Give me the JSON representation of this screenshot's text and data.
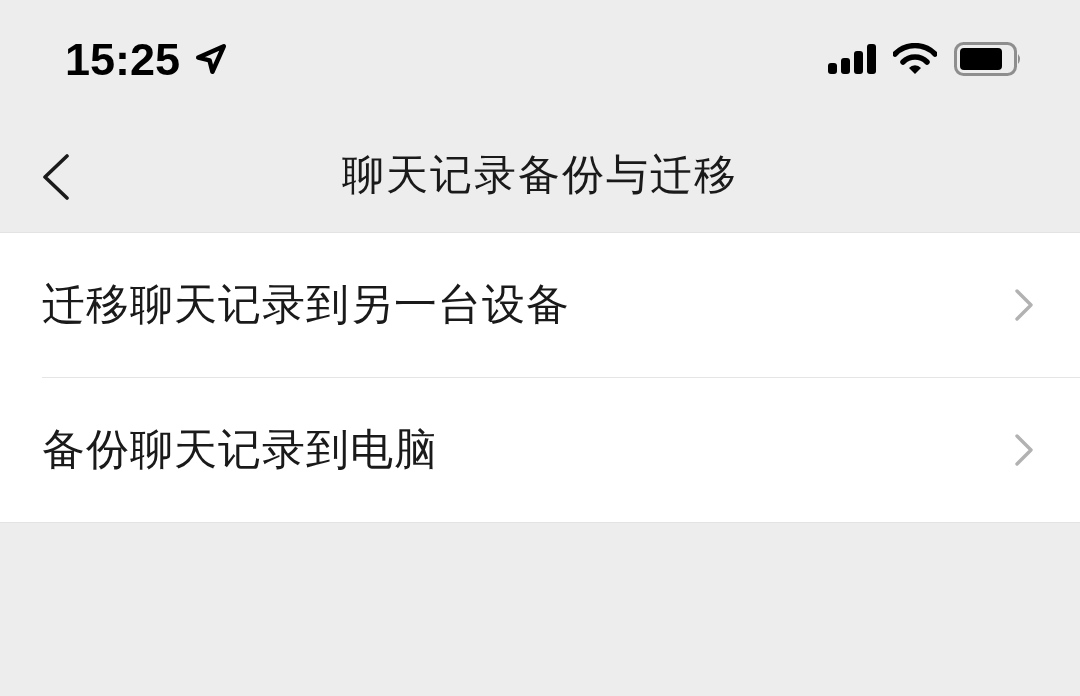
{
  "status_bar": {
    "time": "15:25"
  },
  "nav_bar": {
    "title": "聊天记录备份与迁移"
  },
  "menu": {
    "items": [
      {
        "label": "迁移聊天记录到另一台设备"
      },
      {
        "label": "备份聊天记录到电脑"
      }
    ]
  }
}
